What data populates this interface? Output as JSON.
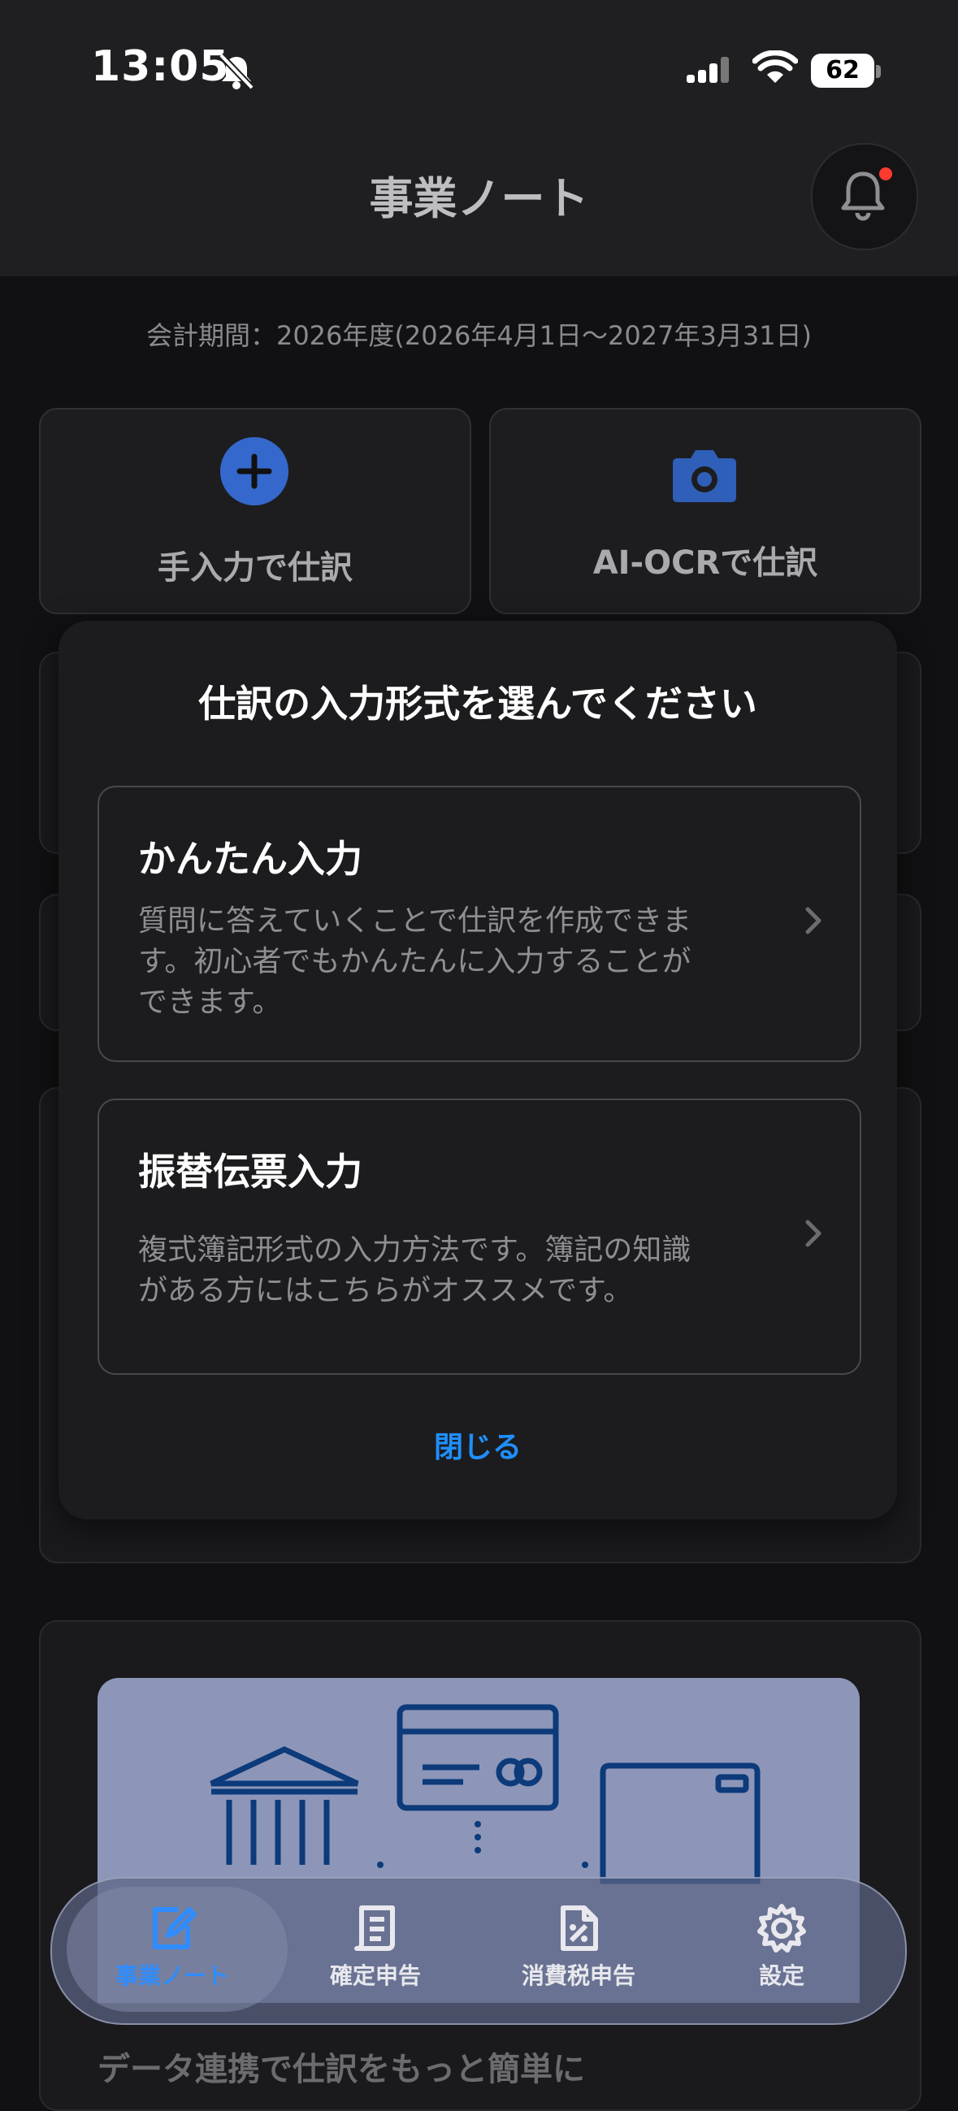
{
  "status_bar": {
    "time": "13:05",
    "battery": "62"
  },
  "header": {
    "title": "事業ノート"
  },
  "period": "会計期間：2026年度(2026年4月1日～2027年3月31日)",
  "actions": {
    "manual": "手入力で仕訳",
    "ocr": "AI-OCRで仕訳"
  },
  "modal": {
    "title": "仕訳の入力形式を選んでください",
    "options": [
      {
        "title": "かんたん入力",
        "desc1": "質問に答えていくことで仕訳を作成できま",
        "desc2": "す。初心者でもかんたんに入力することが",
        "desc3": "できます。"
      },
      {
        "title": "振替伝票入力",
        "desc1": "複式簿記形式の入力方法です。簿記の知識",
        "desc2": "がある方にはこちらがオススメです。"
      }
    ],
    "close": "閉じる"
  },
  "promo": {
    "text": "データ連携で仕訳をもっと簡単に"
  },
  "tabs": [
    {
      "label": "事業ノート",
      "icon": "note-edit-icon"
    },
    {
      "label": "確定申告",
      "icon": "document-icon"
    },
    {
      "label": "消費税申告",
      "icon": "tax-document-icon"
    },
    {
      "label": "設定",
      "icon": "gear-icon"
    }
  ],
  "colors": {
    "accent": "#1e90ff",
    "plus": "#3568cc",
    "camera": "#2f5fb8"
  }
}
